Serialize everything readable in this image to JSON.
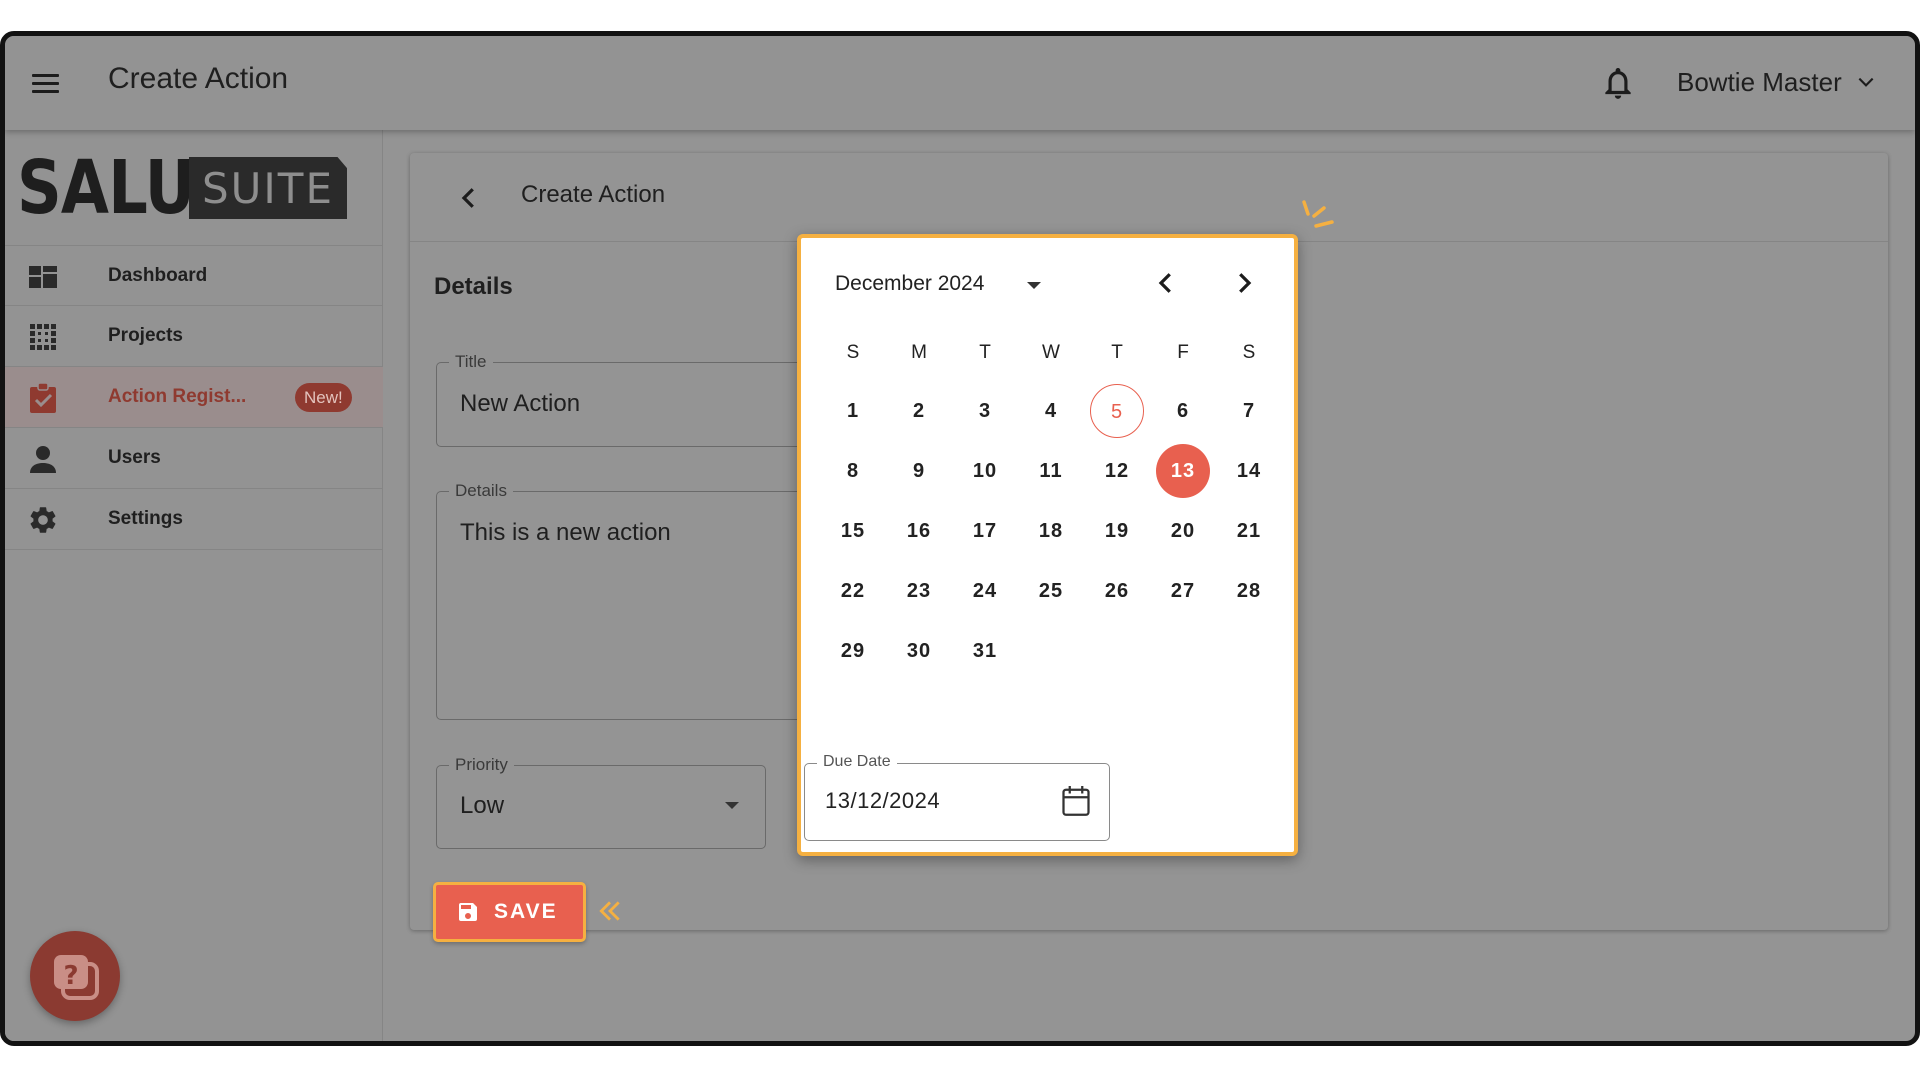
{
  "appbar": {
    "title": "Create Action",
    "user_name": "Bowtie Master"
  },
  "sidebar": {
    "logo_primary": "SALUS",
    "logo_secondary": "SUITE",
    "items": [
      {
        "label": "Dashboard",
        "icon": "dashboard-icon"
      },
      {
        "label": "Projects",
        "icon": "projects-grid-icon"
      },
      {
        "label": "Action Regist...",
        "icon": "clipboard-check-icon",
        "badge": "New!",
        "active": true
      },
      {
        "label": "Users",
        "icon": "user-icon"
      },
      {
        "label": "Settings",
        "icon": "gear-icon"
      }
    ]
  },
  "card": {
    "title": "Create Action",
    "section_title": "Details",
    "title_field": {
      "label": "Title",
      "value": "New Action"
    },
    "details_field": {
      "label": "Details",
      "value": "This is a new action"
    },
    "priority_field": {
      "label": "Priority",
      "value": "Low"
    },
    "save_label": "SAVE"
  },
  "calendar": {
    "month_label": "December 2024",
    "weekdays": [
      "S",
      "M",
      "T",
      "W",
      "T",
      "F",
      "S"
    ],
    "first_weekday_index": 0,
    "days_in_month": 31,
    "today": 5,
    "selected": 13,
    "due_label": "Due Date",
    "due_value": "13/12/2024"
  },
  "colors": {
    "accent": "#e8604f",
    "highlight": "#f5b041",
    "overlay_gray": "#949494"
  }
}
